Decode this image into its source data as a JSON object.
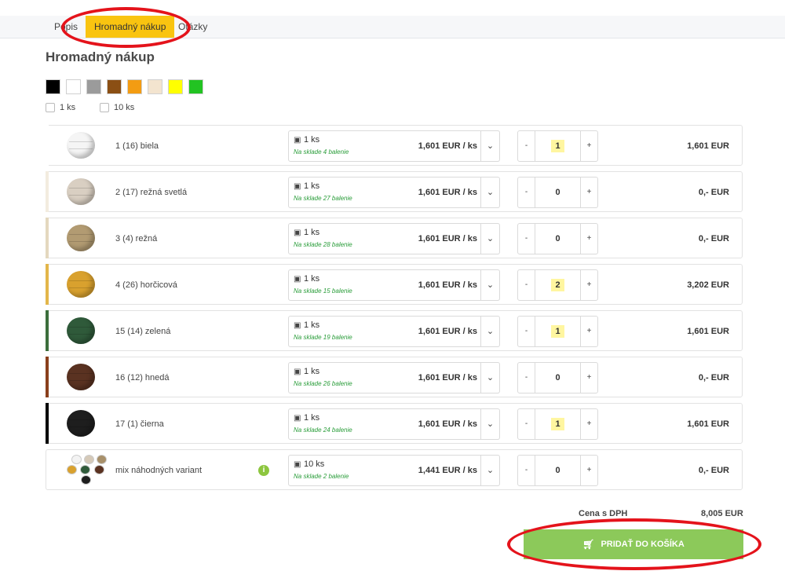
{
  "tabs": [
    {
      "label": "Popis",
      "active": false
    },
    {
      "label": "Hromadný nákup",
      "active": true
    },
    {
      "label": "Otázky",
      "active": false
    }
  ],
  "title": "Hromadný nákup",
  "swatches": [
    "#000000",
    "#ffffff",
    "#9b9b9b",
    "#8b4f14",
    "#f39c12",
    "#f3e4cf",
    "#ffff00",
    "#22c322"
  ],
  "pack_filters": [
    {
      "label": "1 ks",
      "checked": false
    },
    {
      "label": "10 ks",
      "checked": false
    }
  ],
  "rows": [
    {
      "name": "1 (16) biela",
      "unit": "1 ks",
      "stock": "Na sklade 4 balenie",
      "price": "1,601 EUR / ks",
      "qty": "1",
      "total": "1,601 EUR",
      "color": "#f5f5f5",
      "bar": "#ffffff"
    },
    {
      "name": "2 (17) režná svetlá",
      "unit": "1 ks",
      "stock": "Na sklade 27 balenie",
      "price": "1,601 EUR / ks",
      "qty": "0",
      "total": "0,- EUR",
      "color": "#d9cfc2",
      "bar": "#f3ecdf"
    },
    {
      "name": "3 (4) režná",
      "unit": "1 ks",
      "stock": "Na sklade 28 balenie",
      "price": "1,601 EUR / ks",
      "qty": "0",
      "total": "0,- EUR",
      "color": "#b29b72",
      "bar": "#e4d8bf"
    },
    {
      "name": "4 (26) horčicová",
      "unit": "1 ks",
      "stock": "Na sklade 15 balenie",
      "price": "1,601 EUR / ks",
      "qty": "2",
      "total": "3,202 EUR",
      "color": "#d9a12e",
      "bar": "#e3b64a"
    },
    {
      "name": "15 (14) zelená",
      "unit": "1 ks",
      "stock": "Na sklade 19 balenie",
      "price": "1,601 EUR / ks",
      "qty": "1",
      "total": "1,601 EUR",
      "color": "#2f5a3a",
      "bar": "#3c6e3c"
    },
    {
      "name": "16 (12) hnedá",
      "unit": "1 ks",
      "stock": "Na sklade 26 balenie",
      "price": "1,601 EUR / ks",
      "qty": "0",
      "total": "0,- EUR",
      "color": "#5a3221",
      "bar": "#8a3f1c"
    },
    {
      "name": "17 (1) čierna",
      "unit": "1 ks",
      "stock": "Na sklade 24 balenie",
      "price": "1,601 EUR / ks",
      "qty": "1",
      "total": "1,601 EUR",
      "color": "#1e1e1e",
      "bar": "#000000"
    },
    {
      "name": "mix náhodných variant",
      "unit": "10 ks",
      "stock": "Na sklade 2 balenie",
      "price": "1,441 EUR / ks",
      "qty": "0",
      "total": "0,- EUR",
      "color": "",
      "bar": "",
      "mix": true,
      "info": "i"
    }
  ],
  "summary": {
    "label": "Cena s DPH",
    "value": "8,005 EUR"
  },
  "add_button": "PRIDAŤ DO KOŠÍKA",
  "annotation_color": "#e4131b"
}
